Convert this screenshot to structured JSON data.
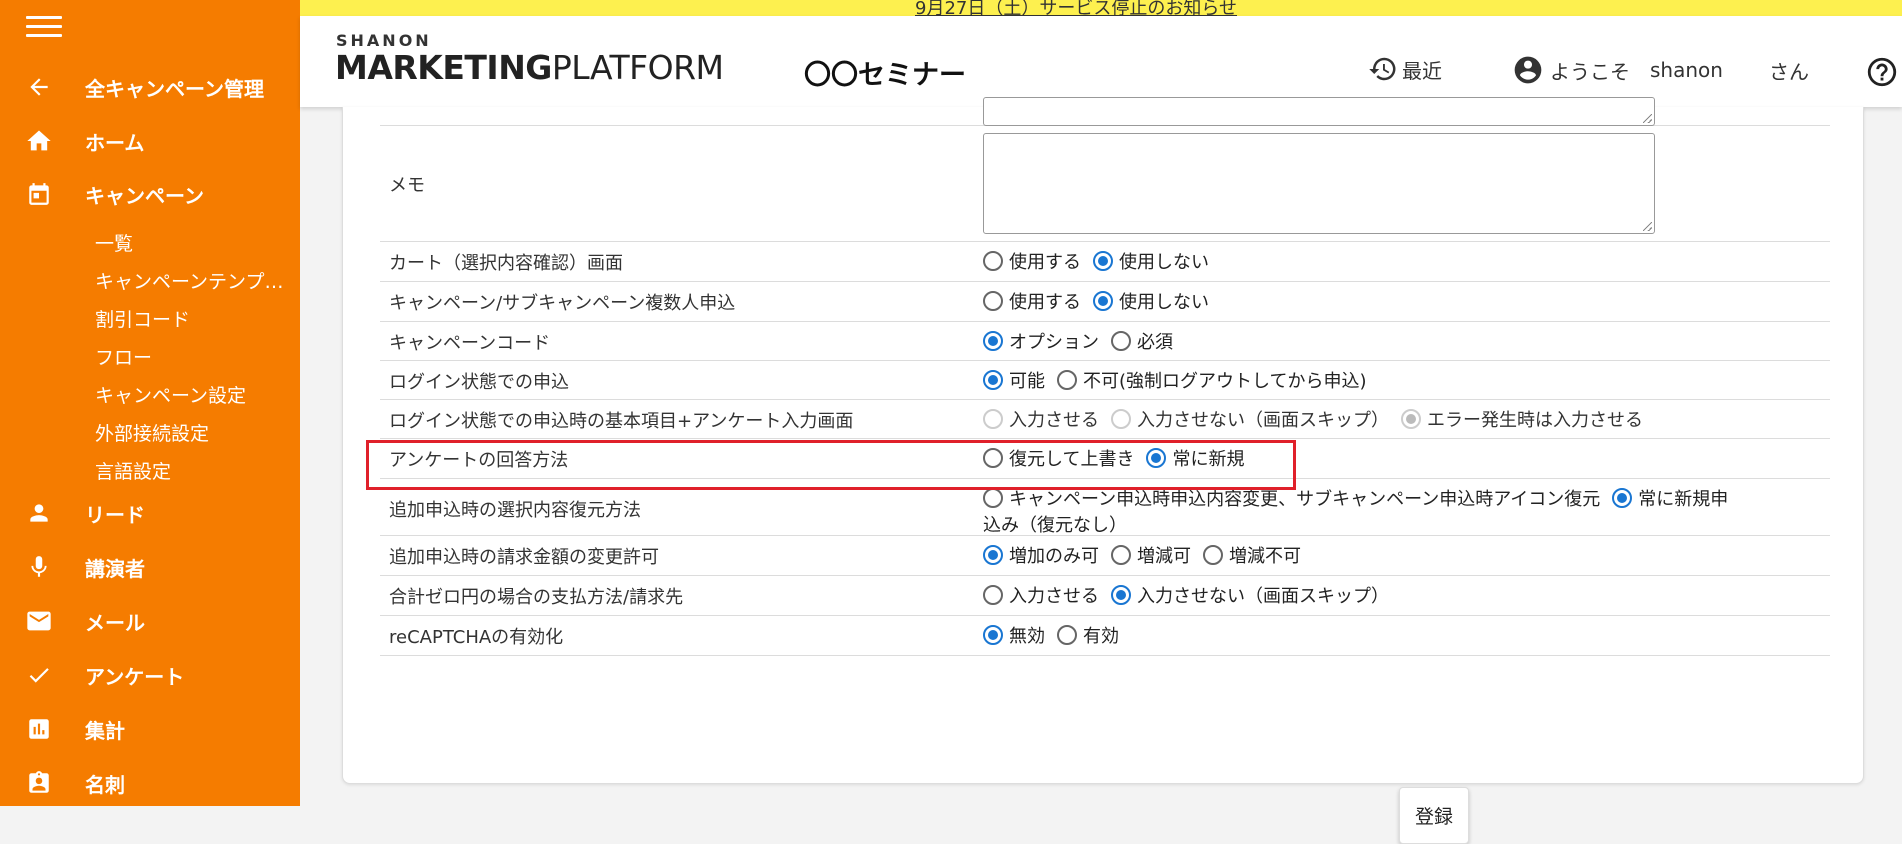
{
  "banner": {
    "text": "9月27日（土）サービス停止のお知らせ"
  },
  "header": {
    "logo_small": "SHANON",
    "logo_marketing": "MARKETING",
    "logo_platform": "PLATFORM",
    "app_title": "〇〇セミナー",
    "recent_label": "最近",
    "welcome_label": "ようこそ",
    "user_name": "shanon",
    "honorific": "さん",
    "help_icon": "help-circle-icon"
  },
  "sidebar": {
    "back_label": "全キャンペーン管理",
    "items": [
      {
        "label": "ホーム",
        "icon": "home-icon"
      },
      {
        "label": "キャンペーン",
        "icon": "calendar-icon"
      },
      {
        "label": "リード",
        "icon": "person-icon"
      },
      {
        "label": "講演者",
        "icon": "mic-icon"
      },
      {
        "label": "メール",
        "icon": "mail-icon"
      },
      {
        "label": "アンケート",
        "icon": "check-icon"
      },
      {
        "label": "集計",
        "icon": "bar-chart-icon"
      },
      {
        "label": "名刺",
        "icon": "badge-icon"
      }
    ],
    "sub_items": [
      {
        "label": "一覧"
      },
      {
        "label": "キャンペーンテンプ…"
      },
      {
        "label": "割引コード"
      },
      {
        "label": "フロー"
      },
      {
        "label": "キャンペーン設定"
      },
      {
        "label": "外部接続設定"
      },
      {
        "label": "言語設定"
      }
    ]
  },
  "form": {
    "memo_label": "メモ",
    "rows": [
      {
        "label": "カート（選択内容確認）画面",
        "options": [
          "使用する",
          "使用しない"
        ],
        "selected": 1
      },
      {
        "label": "キャンペーン/サブキャンペーン複数人申込",
        "options": [
          "使用する",
          "使用しない"
        ],
        "selected": 1
      },
      {
        "label": "キャンペーンコード",
        "options": [
          "オプション",
          "必須"
        ],
        "selected": 0
      },
      {
        "label": "ログイン状態での申込",
        "options": [
          "可能",
          "不可(強制ログアウトしてから申込)"
        ],
        "selected": 0
      },
      {
        "label": "ログイン状態での申込時の基本項目+アンケート入力画面",
        "options": [
          "入力させる",
          "入力させない（画面スキップ）",
          "エラー発生時は入力させる"
        ],
        "selected": 2,
        "disabled": true
      },
      {
        "label": "アンケートの回答方法",
        "options": [
          "復元して上書き",
          "常に新規"
        ],
        "selected": 1
      },
      {
        "label": "追加申込時の選択内容復元方法",
        "options": [
          "キャンペーン申込時申込内容変更、サブキャンペーン申込時アイコン復元",
          "常に新規申"
        ],
        "wrap": "込み（復元なし）",
        "selected": 1
      },
      {
        "label": "追加申込時の請求金額の変更許可",
        "options": [
          "増加のみ可",
          "増減可",
          "増減不可"
        ],
        "selected": 0
      },
      {
        "label": "合計ゼロ円の場合の支払方法/請求先",
        "options": [
          "入力させる",
          "入力させない（画面スキップ）"
        ],
        "selected": 1
      },
      {
        "label": "reCAPTCHAの有効化",
        "options": [
          "無効",
          "有効"
        ],
        "selected": 0
      }
    ],
    "submit_label": "登録"
  }
}
